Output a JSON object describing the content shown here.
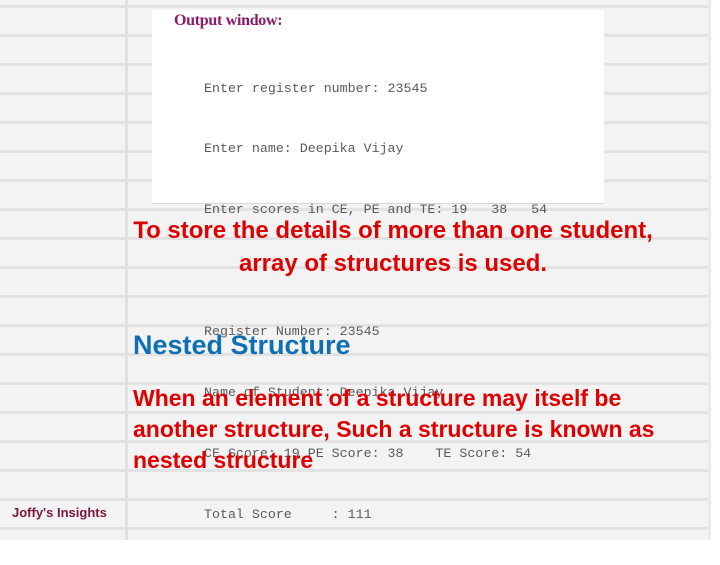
{
  "output_window": {
    "title": "Output window:",
    "input_lines": [
      "Enter register number: 23545",
      "Enter name: Deepika Vijay",
      "Enter scores in CE, PE and TE: 19   38   54"
    ],
    "output_lines": [
      "Register Number: 23545",
      "Name of Student: Deepika Vijay",
      "CE Score: 19 PE Score: 38    TE Score: 54",
      "Total Score     : 111"
    ]
  },
  "paragraph_array": "To store the details of more than one student, array of structures is used.",
  "heading": "Nested Structure",
  "paragraph_nested": "When an element of a structure may itself be another structure, Such a structure is known as nested structure",
  "footer": "Joffy's Insights",
  "colors": {
    "red_text": "#e00000",
    "heading_blue": "#0e6fb5",
    "output_title": "#8b1a6b",
    "footer": "#7a1740"
  }
}
